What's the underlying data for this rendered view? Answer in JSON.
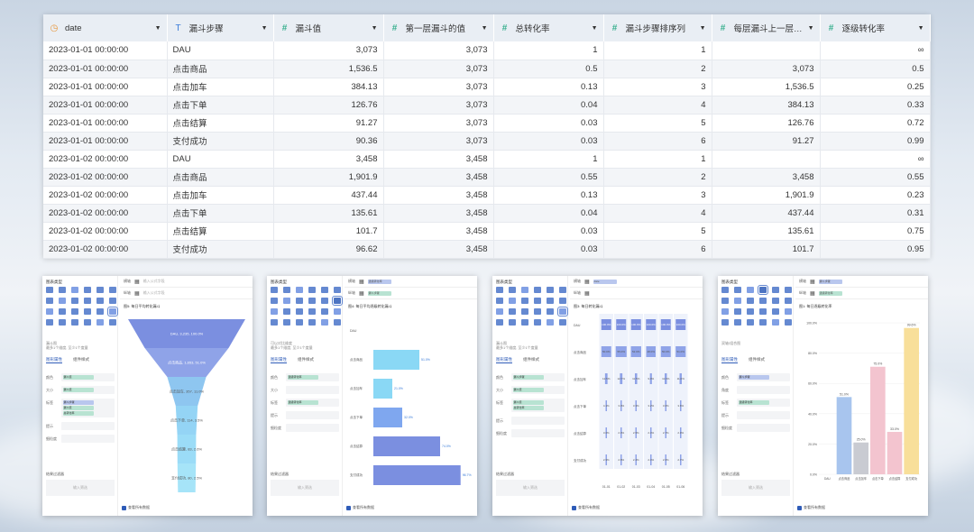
{
  "table": {
    "columns": [
      {
        "label": "date",
        "type": "date"
      },
      {
        "label": "漏斗步骤",
        "type": "text"
      },
      {
        "label": "漏斗值",
        "type": "num"
      },
      {
        "label": "第一层漏斗的值",
        "type": "num"
      },
      {
        "label": "总转化率",
        "type": "num"
      },
      {
        "label": "漏斗步骤排序列",
        "type": "num"
      },
      {
        "label": "每层漏斗上一层漏...",
        "type": "num"
      },
      {
        "label": "逐级转化率",
        "type": "num"
      }
    ],
    "rows": [
      [
        "2023-01-01 00:00:00",
        "DAU",
        "3,073",
        "3,073",
        "1",
        "1",
        "",
        "∞"
      ],
      [
        "2023-01-01 00:00:00",
        "点击商品",
        "1,536.5",
        "3,073",
        "0.5",
        "2",
        "3,073",
        "0.5"
      ],
      [
        "2023-01-01 00:00:00",
        "点击加车",
        "384.13",
        "3,073",
        "0.13",
        "3",
        "1,536.5",
        "0.25"
      ],
      [
        "2023-01-01 00:00:00",
        "点击下单",
        "126.76",
        "3,073",
        "0.04",
        "4",
        "384.13",
        "0.33"
      ],
      [
        "2023-01-01 00:00:00",
        "点击结算",
        "91.27",
        "3,073",
        "0.03",
        "5",
        "126.76",
        "0.72"
      ],
      [
        "2023-01-01 00:00:00",
        "支付成功",
        "90.36",
        "3,073",
        "0.03",
        "6",
        "91.27",
        "0.99"
      ],
      [
        "2023-01-02 00:00:00",
        "DAU",
        "3,458",
        "3,458",
        "1",
        "1",
        "",
        "∞"
      ],
      [
        "2023-01-02 00:00:00",
        "点击商品",
        "1,901.9",
        "3,458",
        "0.55",
        "2",
        "3,458",
        "0.55"
      ],
      [
        "2023-01-02 00:00:00",
        "点击加车",
        "437.44",
        "3,458",
        "0.13",
        "3",
        "1,901.9",
        "0.23"
      ],
      [
        "2023-01-02 00:00:00",
        "点击下单",
        "135.61",
        "3,458",
        "0.04",
        "4",
        "437.44",
        "0.31"
      ],
      [
        "2023-01-02 00:00:00",
        "点击结算",
        "101.7",
        "3,458",
        "0.03",
        "5",
        "135.61",
        "0.75"
      ],
      [
        "2023-01-02 00:00:00",
        "支付成功",
        "96.62",
        "3,458",
        "0.03",
        "6",
        "101.7",
        "0.95"
      ]
    ]
  },
  "editors": [
    {
      "chart_type_label": "图表类型",
      "note": "漏斗图\n最多1个维度, 至少1个度量",
      "tabs": [
        "图形属性",
        "组件样式"
      ],
      "fields": [
        {
          "label": "颜色",
          "chips": [
            {
              "text": "漏斗值",
              "c": "g"
            }
          ]
        },
        {
          "label": "大小",
          "chips": [
            {
              "text": "漏斗值",
              "c": "g"
            }
          ]
        },
        {
          "label": "标签",
          "chips": [
            {
              "text": "漏斗步骤",
              "c": "b"
            },
            {
              "text": "漏斗值",
              "c": "g"
            },
            {
              "text": "总转化率",
              "c": "g"
            }
          ]
        },
        {
          "label": "提示",
          "chips": []
        },
        {
          "label": "细粒度",
          "chips": []
        }
      ],
      "axis1": {
        "label": "横轴",
        "pill": "",
        "placeholder": "输入公式字段"
      },
      "axis2": {
        "label": "纵轴",
        "pill": "",
        "placeholder": "输入公式字段"
      },
      "bottom_label": "结果过滤器",
      "bottom_placeholder": "输入筛选",
      "check_label": "查看所有数据",
      "chart_title": "图5: 每日平均转化漏斗",
      "funnel_labels": [
        "DAU, 3,235, 100.0%",
        "点击商品, 1,653, 51.0%",
        "点击加车, 357, 11.0%",
        "点击下单, 114, 3.5%",
        "点击结算, 83, 2.6%",
        "支付成功, 80, 2.5%"
      ]
    },
    {
      "chart_type_label": "图表类型",
      "note": "可以对比维度\n最多1个维度, 至少1个度量",
      "tabs": [
        "图形属性",
        "组件样式"
      ],
      "fields": [
        {
          "label": "颜色",
          "chips": [
            {
              "text": "逐级转化率",
              "c": "g"
            }
          ]
        },
        {
          "label": "大小",
          "chips": []
        },
        {
          "label": "标签",
          "chips": [
            {
              "text": "逐级转化率",
              "c": "g"
            }
          ]
        },
        {
          "label": "提示",
          "chips": []
        },
        {
          "label": "细粒度",
          "chips": []
        }
      ],
      "axis1": {
        "label": "横轴",
        "pill": "逐级转化率",
        "placeholder": ""
      },
      "axis2": {
        "label": "纵轴",
        "pill": "漏斗步骤",
        "placeholder": ""
      },
      "bottom_label": "结果过滤器",
      "bottom_placeholder": "输入筛选",
      "check_label": "查看所有数据",
      "chart_title": "图4: 每日平均逐级转化漏斗"
    },
    {
      "chart_type_label": "图表类型",
      "note": "漏斗图\n最多1个维度, 至少1个度量",
      "tabs": [
        "图形属性",
        "组件样式"
      ],
      "fields": [
        {
          "label": "颜色",
          "chips": [
            {
              "text": "漏斗步骤",
              "c": "g"
            }
          ]
        },
        {
          "label": "大小",
          "chips": [
            {
              "text": "漏斗值",
              "c": "g"
            }
          ]
        },
        {
          "label": "标签",
          "chips": [
            {
              "text": "漏斗值",
              "c": "g"
            },
            {
              "text": "总转化率",
              "c": "g"
            }
          ]
        },
        {
          "label": "提示",
          "chips": []
        },
        {
          "label": "细粒度",
          "chips": []
        }
      ],
      "axis1": {
        "label": "横轴",
        "pill": "date",
        "placeholder": ""
      },
      "axis2": {
        "label": "纵轴",
        "pill": "",
        "placeholder": ""
      },
      "bottom_label": "结果过滤器",
      "bottom_placeholder": "输入筛选",
      "check_label": "查看所有数据",
      "chart_title": "图3: 每日转化漏斗"
    },
    {
      "chart_type_label": "图表类型",
      "note": "双轴/组合图",
      "tabs": [
        "图形属性",
        "组件样式"
      ],
      "fields": [
        {
          "label": "颜色",
          "chips": [
            {
              "text": "漏斗步骤",
              "c": "b"
            }
          ]
        },
        {
          "label": "角度",
          "chips": []
        },
        {
          "label": "标签",
          "chips": [
            {
              "text": "逐级转化率",
              "c": "g"
            }
          ]
        },
        {
          "label": "提示",
          "chips": []
        },
        {
          "label": "细粒度",
          "chips": []
        }
      ],
      "axis1": {
        "label": "横轴",
        "pill": "漏斗步骤",
        "placeholder": ""
      },
      "axis2": {
        "label": "纵轴",
        "pill": "逐级转化率",
        "placeholder": ""
      },
      "bottom_label": "结果过滤器",
      "bottom_placeholder": "输入筛选",
      "check_label": "查看所有数据",
      "chart_title": "图1: 每日逐级转化率"
    }
  ],
  "chart_data": [
    {
      "type": "bar",
      "title": "图5: 每日平均转化漏斗",
      "categories": [
        "DAU",
        "点击商品",
        "点击加车",
        "点击下单",
        "点击结算",
        "支付成功"
      ],
      "values": [
        3235,
        1653,
        357,
        114,
        83,
        80
      ],
      "percent": [
        "100.0%",
        "51.0%",
        "11.0%",
        "3.5%",
        "2.6%",
        "2.5%"
      ],
      "color": "#7b8fe0"
    },
    {
      "type": "bar",
      "title": "图4: 每日平均逐级转化漏斗",
      "categories": [
        "DAU",
        "点击商品",
        "点击加车",
        "点击下单",
        "点击结算",
        "支付成功"
      ],
      "values": [
        null,
        51.0,
        21.0,
        32.0,
        74.0,
        96.7
      ],
      "labels": [
        "",
        "51.0%",
        "21.0%",
        "32.0%",
        "74.0%",
        "96.7%"
      ],
      "xlim": [
        0,
        100
      ]
    },
    {
      "type": "bar",
      "title": "图3: 每日转化漏斗",
      "x": [
        "01-01",
        "01-02",
        "01-03",
        "01-04",
        "01-05",
        "01-06"
      ],
      "rows": [
        "DAU",
        "点击商品",
        "点击加车",
        "点击下单",
        "点击结算",
        "支付成功"
      ],
      "values": [
        [
          "100.0%",
          "100.0%",
          "100.0%",
          "100.0%",
          "100.0%",
          "100.0%"
        ],
        [
          "50.0%",
          "55.0%",
          "52.0%",
          "48.0%",
          "50.0%",
          "51.0%"
        ],
        [
          "12.5%",
          "12.7%",
          "11.5%",
          "9.9%",
          "11.0%",
          "11.0%"
        ],
        [
          "4.1%",
          "3.9%",
          "3.3%",
          "3.2%",
          "3.6%",
          "3.6%"
        ],
        [
          "3.0%",
          "2.9%",
          "2.5%",
          "2.4%",
          "2.7%",
          "2.9%"
        ],
        [
          "2.9%",
          "2.8%",
          "2.4%",
          "2.4%",
          "2.6%",
          "2.7%"
        ]
      ]
    },
    {
      "type": "bar",
      "title": "图1: 每日逐级转化率",
      "categories": [
        "DAU",
        "点击商品",
        "点击加车",
        "点击下单",
        "点击结算",
        "支付成功"
      ],
      "values": [
        null,
        51.0,
        21.0,
        71.0,
        28.0,
        96.6
      ],
      "labels": [
        "",
        "51.0%",
        "25.0%",
        "75.0%",
        "33.0%",
        "99.6%"
      ],
      "colors": [
        "#b9cdf2",
        "#a8c5ee",
        "#c9cbd2",
        "#f3c4cf",
        "#f3c4cf",
        "#f8df9a"
      ],
      "yticks": [
        "100.0%",
        "80.0%",
        "60.0%",
        "40.0%",
        "20.0%",
        "0.0%"
      ]
    }
  ]
}
